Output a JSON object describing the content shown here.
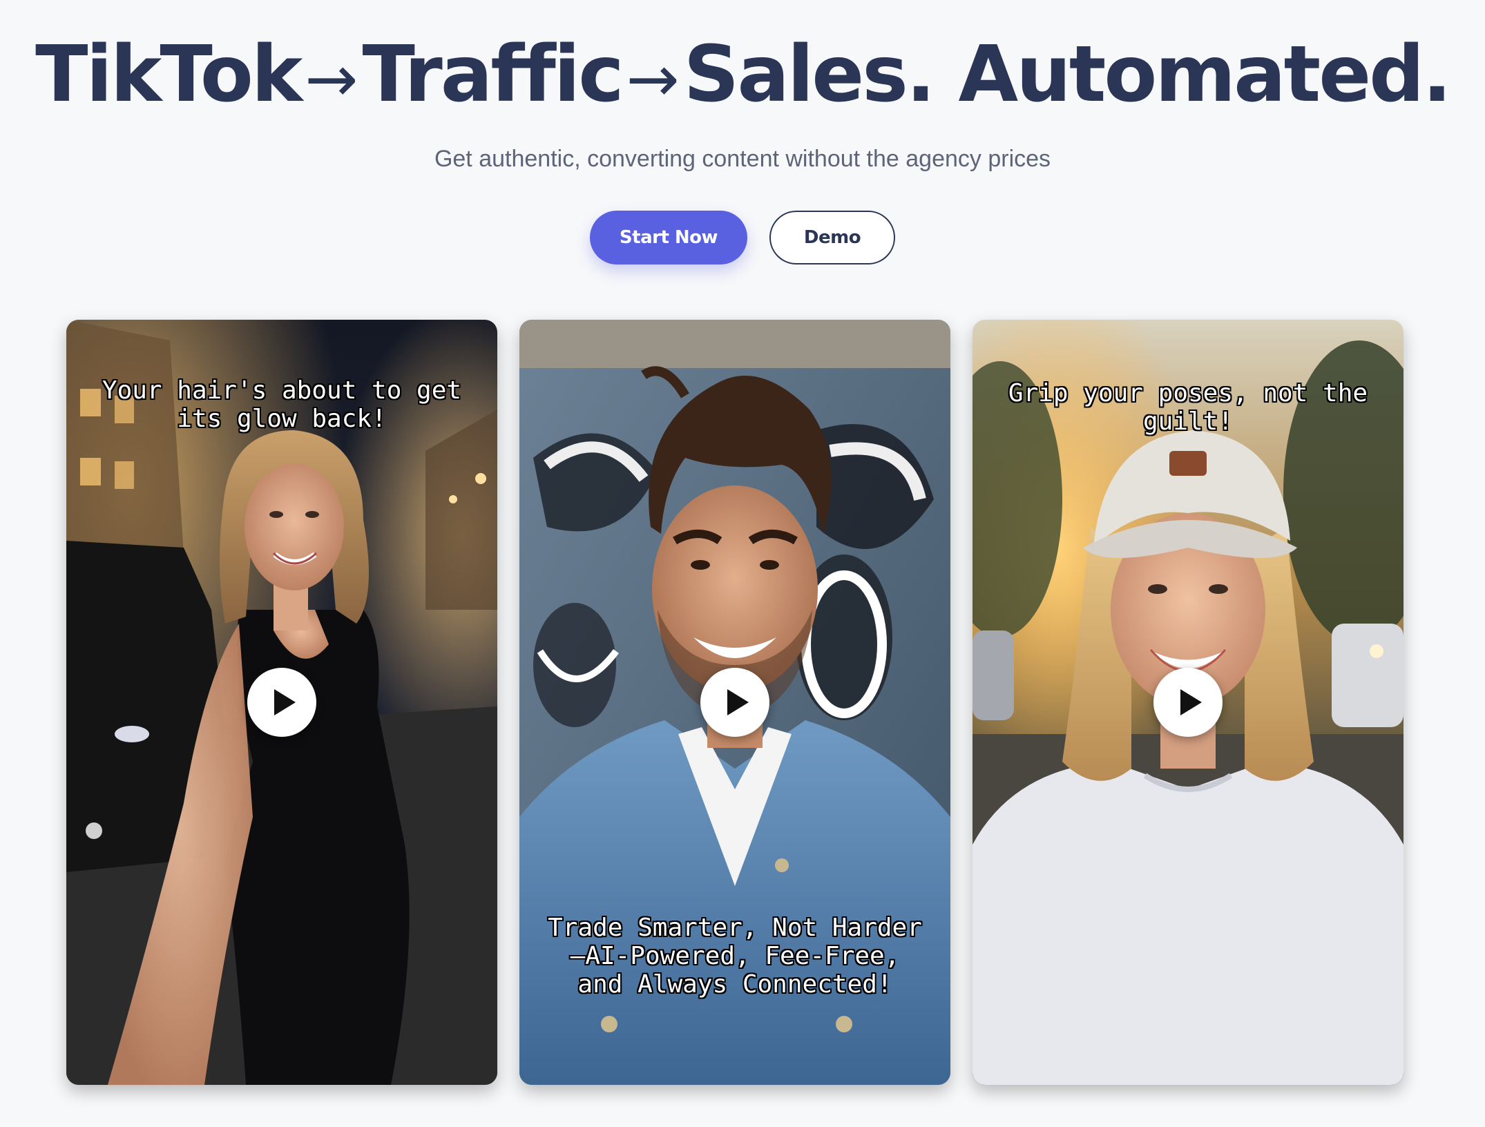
{
  "hero": {
    "title_part1": "TikTok",
    "arrow1": "→",
    "title_part2": "Traffic",
    "arrow2": "→",
    "title_part3": "Sales. Automated.",
    "subtitle": "Get authentic, converting content without the agency prices"
  },
  "cta": {
    "primary_label": "Start Now",
    "secondary_label": "Demo"
  },
  "videos": [
    {
      "caption": "Your hair's about to get its glow back!"
    },
    {
      "caption": "Trade Smarter, Not Harder—AI-Powered, Fee-Free, and Always Connected!"
    },
    {
      "caption": "Grip your poses, not the guilt!"
    }
  ],
  "colors": {
    "heading": "#2b3657",
    "accent": "#5a61e0",
    "subtitle": "#5e6478",
    "background": "#f7f8fa"
  },
  "icons": [
    "play-icon"
  ]
}
